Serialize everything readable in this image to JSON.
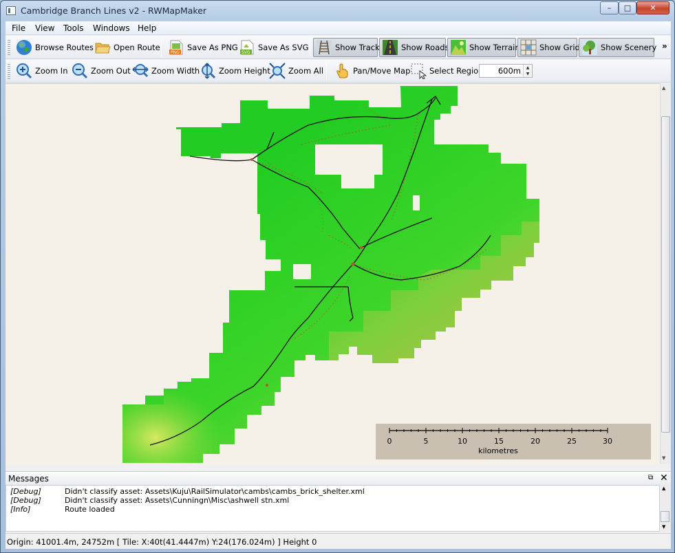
{
  "window": {
    "title": "Cambridge Branch Lines v2 - RWMapMaker",
    "min_symbol": "–",
    "max_symbol": "□",
    "close_symbol": "✕"
  },
  "menu": [
    "File",
    "View",
    "Tools",
    "Windows",
    "Help"
  ],
  "toolbar_main": {
    "browse_routes": "Browse Routes",
    "open_route": "Open Route",
    "save_png": "Save As PNG",
    "save_svg": "Save As SVG",
    "show_track": "Show Track",
    "show_roads": "Show Roads",
    "show_terrain": "Show Terrain",
    "show_grid": "Show Grid",
    "show_scenery": "Show Scenery",
    "more": "»"
  },
  "toolbar_view": {
    "zoom_in": "Zoom In",
    "zoom_out": "Zoom Out",
    "zoom_width": "Zoom Width",
    "zoom_height": "Zoom Height",
    "zoom_all": "Zoom All",
    "pan_move": "Pan/Move Map",
    "select_region": "Select Region",
    "region_size": "600m"
  },
  "scale_bar": {
    "ticks": [
      "0",
      "5",
      "10",
      "15",
      "20",
      "25",
      "30"
    ],
    "unit": "kilometres"
  },
  "messages": {
    "title": "Messages",
    "entries": [
      {
        "level": "[Debug]",
        "text": "Didn't classify asset: Assets\\Kuju\\RailSimulator\\cambs\\cambs_brick_shelter.xml"
      },
      {
        "level": "[Debug]",
        "text": "Didn't classify asset: Assets\\Cunningn\\Misc\\ashwell stn.xml"
      },
      {
        "level": "[Info]",
        "text": "Route loaded"
      }
    ]
  },
  "status": {
    "text": "Origin: 41001.4m, 24752m [ Tile: X:40t(41.4447m)  Y:24(176.024m) ]  Height 0"
  },
  "colors": {
    "terrain_low": "#22cc22",
    "terrain_mid": "#55dd22",
    "terrain_high": "#cce055",
    "track": "#111111",
    "scenery": "#c05030",
    "map_background": "#f5f0e8"
  }
}
